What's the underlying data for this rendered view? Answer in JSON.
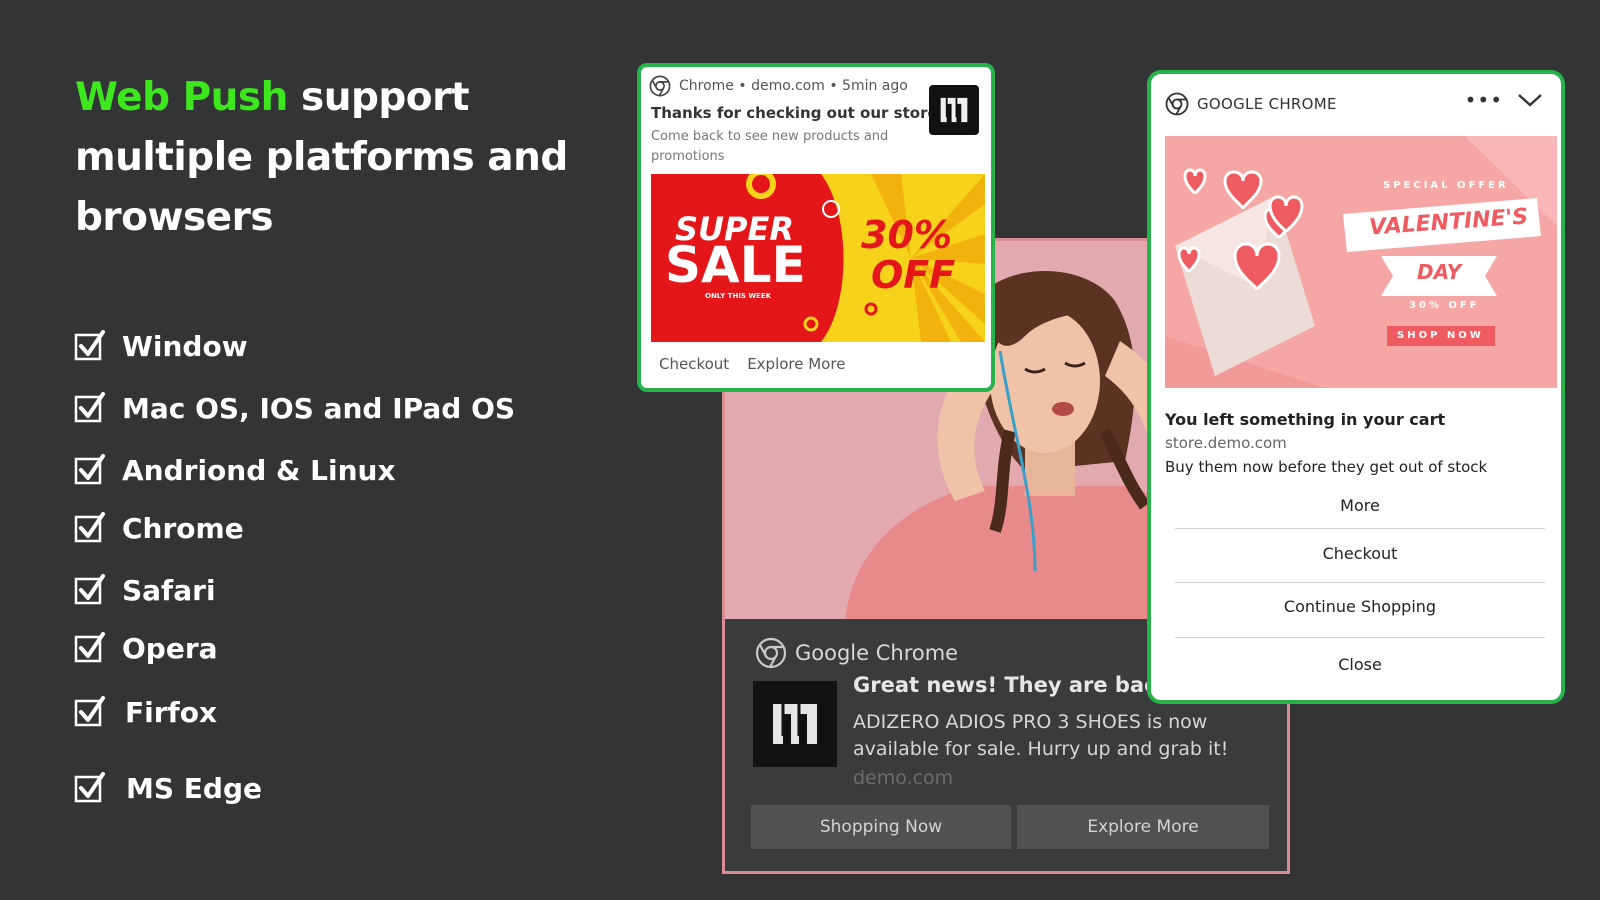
{
  "headline": {
    "accent": "Web Push",
    "rest": " support multiple platforms and browsers"
  },
  "features": [
    {
      "label": "Window",
      "icon": "checkbox-checked-icon"
    },
    {
      "label": "Mac OS, IOS and IPad OS",
      "icon": "checkbox-checked-icon"
    },
    {
      "label": "Andriond & Linux",
      "icon": "checkbox-checked-icon"
    },
    {
      "label": "Chrome",
      "icon": "checkbox-checked-icon"
    },
    {
      "label": "Safari",
      "icon": "checkbox-checked-icon"
    },
    {
      "label": "Opera",
      "icon": "checkbox-checked-icon"
    },
    {
      "label": "Firfox",
      "icon": "checkbox-checked-icon"
    },
    {
      "label": "MS Edge",
      "icon": "checkbox-checked-icon"
    }
  ],
  "small_notification": {
    "header": "Chrome • demo.com • 5min ago",
    "title": "Thanks for checking out our store!",
    "body": "Come back to see new products and promotions",
    "banner": {
      "line1": "SUPER",
      "line2": "SALE",
      "sub": "ONLY THIS WEEK",
      "pct": "30%",
      "off": "OFF"
    },
    "actions": [
      "Checkout",
      "Explore More"
    ]
  },
  "photo_notification": {
    "app": "Google Chrome",
    "title": "Great news! They are back!",
    "body": "ADIZERO ADIOS PRO 3 SHOES is now available for sale. Hurry up and grab it!",
    "domain": "demo.com",
    "buttons": [
      "Shopping Now",
      "Explore More"
    ]
  },
  "big_notification": {
    "app": "GOOGLE CHROME",
    "menu_dots": "•••",
    "banner": {
      "special": "SPECIAL OFFER",
      "valentine": "VALENTINE'S",
      "day": "DAY",
      "pct": "30% OFF",
      "cta": "SHOP NOW"
    },
    "title": "You left something in your cart",
    "domain": "store.demo.com",
    "body": "Buy them now before they get out of stock",
    "actions": [
      "More",
      "Checkout",
      "Continue Shopping",
      "Close"
    ]
  },
  "colors": {
    "background": "#333436",
    "accent_green": "#3ee61e",
    "card_border_green": "#27b24a",
    "photo_border_pink": "#d88d92"
  }
}
